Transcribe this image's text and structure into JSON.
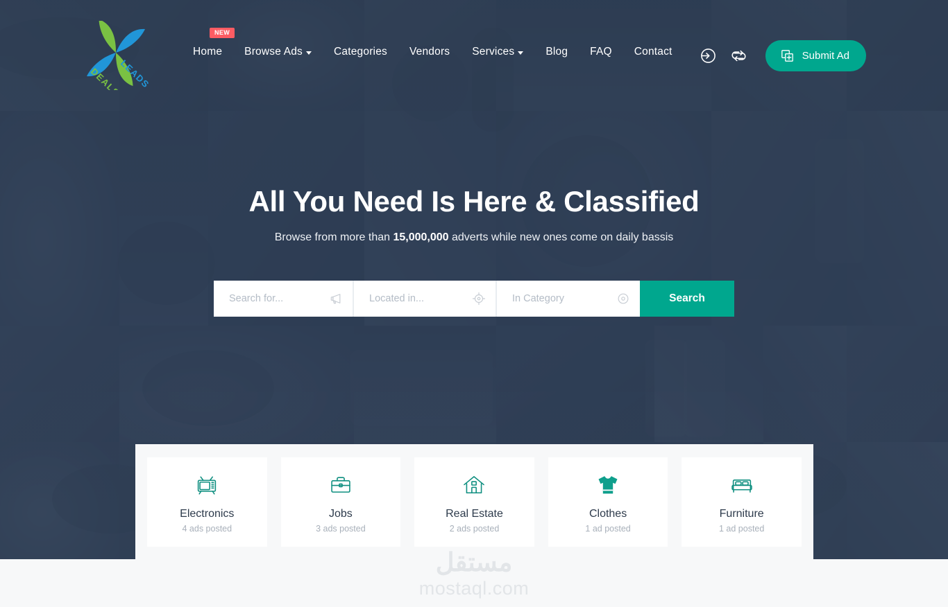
{
  "header": {
    "logo": {
      "name": "deals-leads-logo",
      "word_left": "DEALS",
      "word_right": "LEADS",
      "green": "#7ac143",
      "blue": "#2196d8"
    },
    "nav": [
      {
        "label": "Home",
        "badge": "NEW",
        "has_dropdown": false
      },
      {
        "label": "Browse Ads",
        "badge": "",
        "has_dropdown": true
      },
      {
        "label": "Categories",
        "badge": "",
        "has_dropdown": false
      },
      {
        "label": "Vendors",
        "badge": "",
        "has_dropdown": false
      },
      {
        "label": "Services",
        "badge": "",
        "has_dropdown": true
      },
      {
        "label": "Blog",
        "badge": "",
        "has_dropdown": false
      },
      {
        "label": "FAQ",
        "badge": "",
        "has_dropdown": false
      },
      {
        "label": "Contact",
        "badge": "",
        "has_dropdown": false
      }
    ],
    "icons": [
      {
        "name": "login-icon"
      },
      {
        "name": "compare-icon"
      }
    ],
    "submit_ad_label": "Submit Ad",
    "accent_color": "#00a78e",
    "badge_color": "#fc5c63"
  },
  "hero": {
    "title": "All You Need Is Here & Classified",
    "subtitle_before": "Browse from more than ",
    "subtitle_highlight": "15,000,000",
    "subtitle_after": " adverts while new ones come on daily bassis",
    "overlay_color": "#2d3d53"
  },
  "search": {
    "keyword_placeholder": "Search for...",
    "keyword_value": "",
    "location_placeholder": "Located in...",
    "location_value": "",
    "category_placeholder": "In Category",
    "category_value": "",
    "button_label": "Search",
    "icons": {
      "keyword": "megaphone-icon",
      "location": "crosshair-icon",
      "category": "target-circle-icon"
    }
  },
  "categories": [
    {
      "name": "Electronics",
      "count": "4 ads posted",
      "icon": "tv-icon"
    },
    {
      "name": "Jobs",
      "count": "3 ads posted",
      "icon": "briefcase-icon"
    },
    {
      "name": "Real Estate",
      "count": "2 ads posted",
      "icon": "house-icon"
    },
    {
      "name": "Clothes",
      "count": "1 ad posted",
      "icon": "tshirt-icon"
    },
    {
      "name": "Furniture",
      "count": "1 ad posted",
      "icon": "bed-icon"
    }
  ],
  "watermark": {
    "arabic": "مستقل",
    "latin": "mostaql.com"
  }
}
